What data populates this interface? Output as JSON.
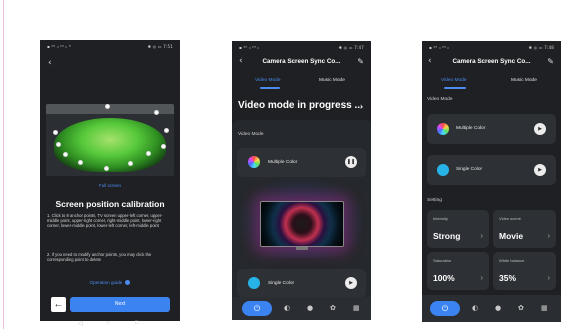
{
  "screen1": {
    "status_left": "▪ ⁴ᴳ ᵢₗ ⁴ᴳ ᵢₗ ᴺ",
    "status_right": "✱ ◎ ▭ 7:51",
    "back_icon": "back-arrow-icon",
    "full_screen": "Full screen",
    "title": "Screen position calibration",
    "instruction_1": "1. Click to 8 anchor points, TV screen upper-left corner, upper-middle point, upper-right corner, right-middle point, lower-right corner, lower-middle point, lower-left corner, left-middle point",
    "instruction_2": "2. If you need to modify anchor points, you may click the corresponding point to delete",
    "guide_link": "Operation guide",
    "next_label": "Next"
  },
  "screen2": {
    "status_left": "▪ ⁴ᴳ ᵢₗ ⁴ᴳ ᵢₗ",
    "status_right": "✱ ◎ ▭ 7:47",
    "title": "Camera Screen Sync Co...",
    "tab_video": "Video Mode",
    "tab_music": "Music Mode",
    "progress_text": "Video mode in progress ...",
    "section_label": "Video Mode",
    "card_multiple": "Multiple Color",
    "card_single": "Single Color"
  },
  "screen3": {
    "status_left": "▪ ⁴ᴳ ᵢₗ ⁴ᴳ ᵢₗ",
    "status_right": "✱ ◎ ▭ 7:48",
    "title": "Camera Screen Sync Co...",
    "tab_video": "Video Mode",
    "tab_music": "Music Mode",
    "section_video": "Video Mode",
    "card_multiple": "Multiple Color",
    "card_single": "Single Color",
    "section_setting": "Setting",
    "intensity_label": "Intensity",
    "intensity_value": "Strong",
    "scene_label": "Video scene",
    "scene_value": "Movie",
    "saturation_label": "Saturation",
    "saturation_value": "100%",
    "white_balance_label": "White balance",
    "white_balance_value": "35%"
  },
  "colors": {
    "accent": "#3b83f1",
    "link": "#4c8cf1",
    "phone_bg": "#1e2023",
    "card_bg": "#2d3034",
    "single_color": "#27b3e8"
  }
}
